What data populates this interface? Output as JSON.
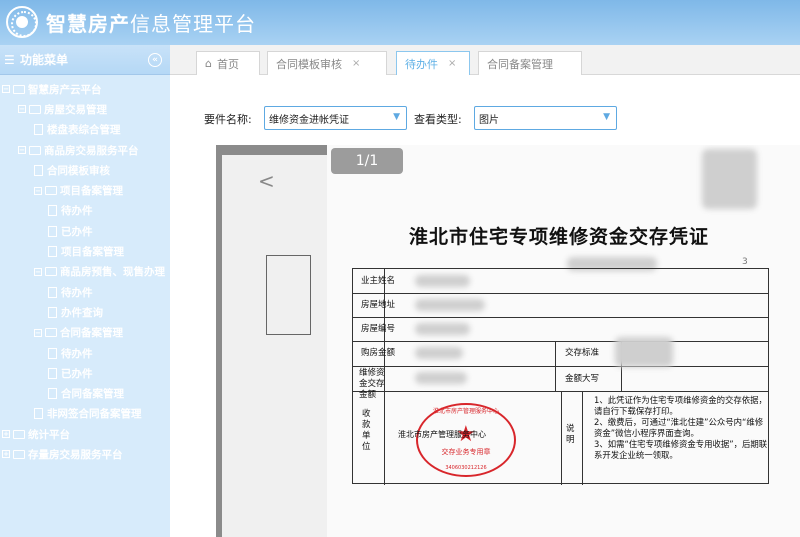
{
  "header": {
    "title_bold": "智慧房产",
    "title_rest": "信息管理平台"
  },
  "sidebar": {
    "title": "功能菜单",
    "collapse_glyph": "«",
    "items": [
      {
        "label": "智慧房产云平台",
        "level": 0,
        "toggle": "−",
        "type": "folder"
      },
      {
        "label": "房屋交易管理",
        "level": 1,
        "toggle": "−",
        "type": "folder"
      },
      {
        "label": "楼盘表综合管理",
        "level": 2,
        "type": "file"
      },
      {
        "label": "商品房交易服务平台",
        "level": 1,
        "toggle": "−",
        "type": "folder"
      },
      {
        "label": "合同模板审核",
        "level": 2,
        "type": "file"
      },
      {
        "label": "项目备案管理",
        "level": 2,
        "toggle": "−",
        "type": "folder"
      },
      {
        "label": "待办件",
        "level": 3,
        "type": "file"
      },
      {
        "label": "已办件",
        "level": 3,
        "type": "file"
      },
      {
        "label": "项目备案管理",
        "level": 3,
        "type": "file"
      },
      {
        "label": "商品房预售、现售办理",
        "level": 2,
        "toggle": "−",
        "type": "folder"
      },
      {
        "label": "待办件",
        "level": 3,
        "type": "file"
      },
      {
        "label": "办件查询",
        "level": 3,
        "type": "file"
      },
      {
        "label": "合同备案管理",
        "level": 2,
        "toggle": "−",
        "type": "folder"
      },
      {
        "label": "待办件",
        "level": 3,
        "type": "file"
      },
      {
        "label": "已办件",
        "level": 3,
        "type": "file"
      },
      {
        "label": "合同备案管理",
        "level": 3,
        "type": "file"
      },
      {
        "label": "非网签合同备案管理",
        "level": 2,
        "type": "file"
      },
      {
        "label": "统计平台",
        "level": 0,
        "toggle": "+",
        "type": "folder"
      },
      {
        "label": "存量房交易服务平台",
        "level": 0,
        "toggle": "+",
        "type": "folder"
      }
    ]
  },
  "tabs": [
    {
      "label": "首页",
      "closable": false,
      "active": false
    },
    {
      "label": "合同模板审核",
      "closable": true,
      "active": false
    },
    {
      "label": "待办件",
      "closable": true,
      "active": true
    },
    {
      "label": "合同备案管理",
      "closable": false,
      "active": false
    }
  ],
  "tab_close_glyph": "×",
  "filters": {
    "doc_name_label": "要件名称:",
    "doc_name_value": "维修资金进帐凭证",
    "view_type_label": "查看类型:",
    "view_type_value": "图片"
  },
  "viewer": {
    "pager": "1/1",
    "nav_glyph": "<",
    "document": {
      "title": "淮北市住宅专项维修资金交存凭证",
      "number_suffix": "3",
      "fields": {
        "owner": "业主姓名",
        "address": "房屋地址",
        "house_no": "房屋编号",
        "price": "购房金额",
        "standard": "交存标准",
        "fund": "维修资金交存金额",
        "amount_upper": "金额大写",
        "receiver": "收款单位",
        "note_label": "说明"
      },
      "stamp_org": "淮北市房产管理服务中心",
      "stamp_sub": "交存业务专用章",
      "stamp_number": "3406030212126",
      "stamp_label": "淮北市房产管理服务中心",
      "notes": [
        "1、此凭证作为住宅专项维修资金的交存依据，请自行下载保存打印。",
        "2、缴费后，可通过“淮北住建”公众号内“维修资金”微信小程序界面查询。",
        "3、如需“住宅专项维修资金专用收据”，后期联系开发企业统一领取。"
      ]
    }
  },
  "colors": {
    "accent": "#5fb0e6",
    "stamp": "#d8262b",
    "sidebar": "#d7ebfb"
  }
}
